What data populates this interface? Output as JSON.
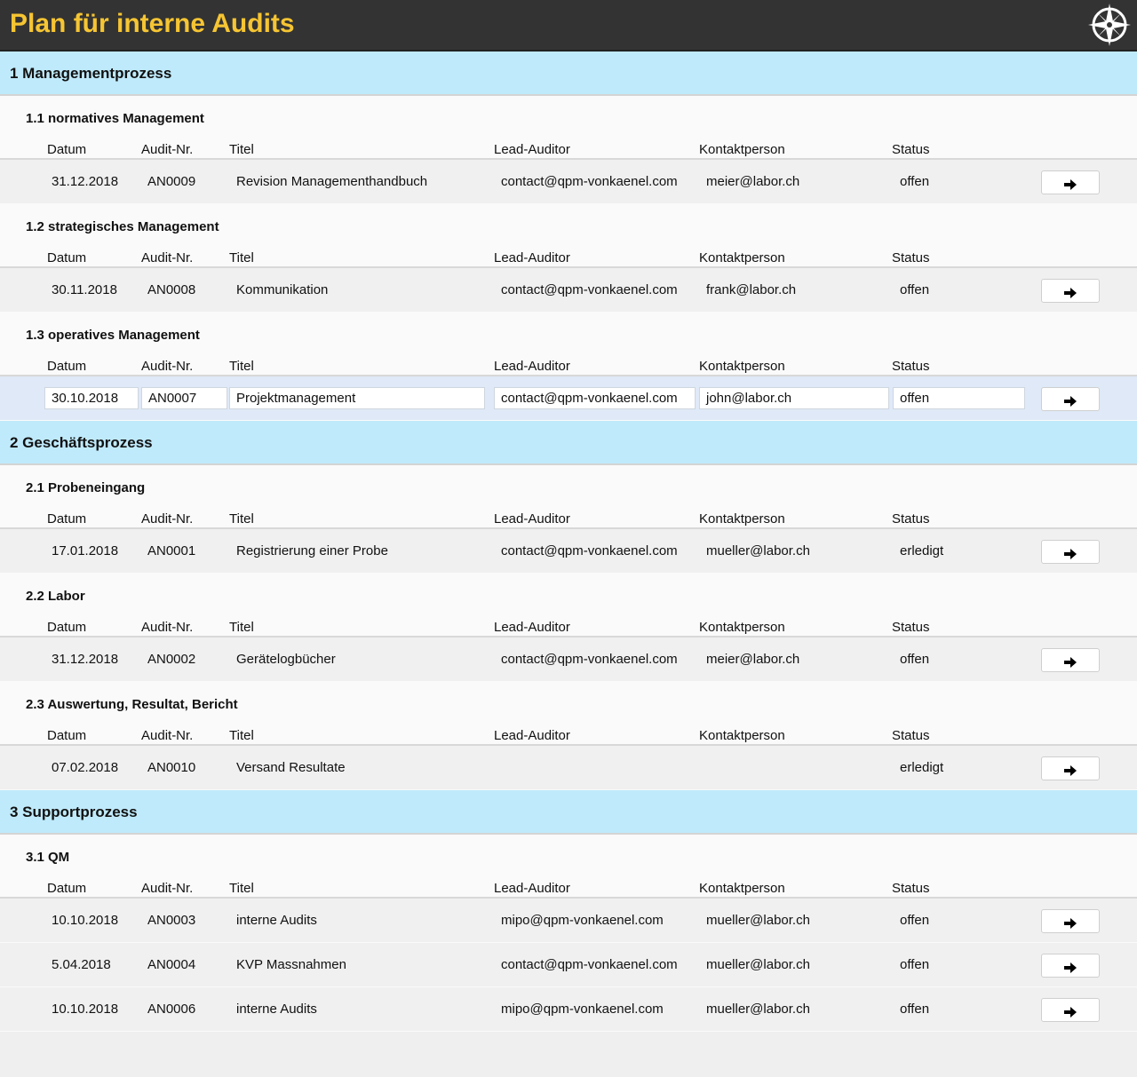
{
  "app": {
    "title": "Plan für interne Audits"
  },
  "columns": [
    "Datum",
    "Audit-Nr.",
    "Titel",
    "Lead-Auditor",
    "Kontaktperson",
    "Status"
  ],
  "colors": {
    "header_bg": "#333333",
    "title": "#f6c533",
    "section_bg": "#bfeafb",
    "selected_row": "#dfe9f7"
  },
  "sections": [
    {
      "label": "1 Managementprozess",
      "subsections": [
        {
          "label": "1.1 normatives Management",
          "rows": [
            {
              "date": "31.12.2018",
              "nr": "AN0009",
              "title": "Revision Managementhandbuch",
              "lead": "contact@qpm-vonkaenel.com",
              "contact": "meier@labor.ch",
              "status": "offen"
            }
          ]
        },
        {
          "label": "1.2 strategisches Management",
          "rows": [
            {
              "date": "30.11.2018",
              "nr": "AN0008",
              "title": "Kommunikation",
              "lead": "contact@qpm-vonkaenel.com",
              "contact": "frank@labor.ch",
              "status": "offen"
            }
          ]
        },
        {
          "label": "1.3 operatives Management",
          "rows": [
            {
              "date": "30.10.2018",
              "nr": "AN0007",
              "title": "Projektmanagement",
              "lead": "contact@qpm-vonkaenel.com",
              "contact": "john@labor.ch",
              "status": "offen",
              "selected": true
            }
          ]
        }
      ]
    },
    {
      "label": "2 Geschäftsprozess",
      "subsections": [
        {
          "label": "2.1 Probeneingang",
          "rows": [
            {
              "date": "17.01.2018",
              "nr": "AN0001",
              "title": "Registrierung einer Probe",
              "lead": "contact@qpm-vonkaenel.com",
              "contact": "mueller@labor.ch",
              "status": "erledigt"
            }
          ]
        },
        {
          "label": "2.2 Labor",
          "rows": [
            {
              "date": "31.12.2018",
              "nr": "AN0002",
              "title": "Gerätelogbücher",
              "lead": "contact@qpm-vonkaenel.com",
              "contact": "meier@labor.ch",
              "status": "offen"
            }
          ]
        },
        {
          "label": "2.3 Auswertung, Resultat, Bericht",
          "rows": [
            {
              "date": "07.02.2018",
              "nr": "AN0010",
              "title": "Versand Resultate",
              "lead": "",
              "contact": "",
              "status": "erledigt"
            }
          ]
        }
      ]
    },
    {
      "label": "3 Supportprozess",
      "subsections": [
        {
          "label": "3.1 QM",
          "rows": [
            {
              "date": "10.10.2018",
              "nr": "AN0003",
              "title": "interne Audits",
              "lead": "mipo@qpm-vonkaenel.com",
              "contact": "mueller@labor.ch",
              "status": "offen"
            },
            {
              "date": "5.04.2018",
              "nr": "AN0004",
              "title": "KVP Massnahmen",
              "lead": "contact@qpm-vonkaenel.com",
              "contact": "mueller@labor.ch",
              "status": "offen"
            },
            {
              "date": "10.10.2018",
              "nr": "AN0006",
              "title": "interne Audits",
              "lead": "mipo@qpm-vonkaenel.com",
              "contact": "mueller@labor.ch",
              "status": "offen"
            }
          ]
        }
      ]
    }
  ]
}
